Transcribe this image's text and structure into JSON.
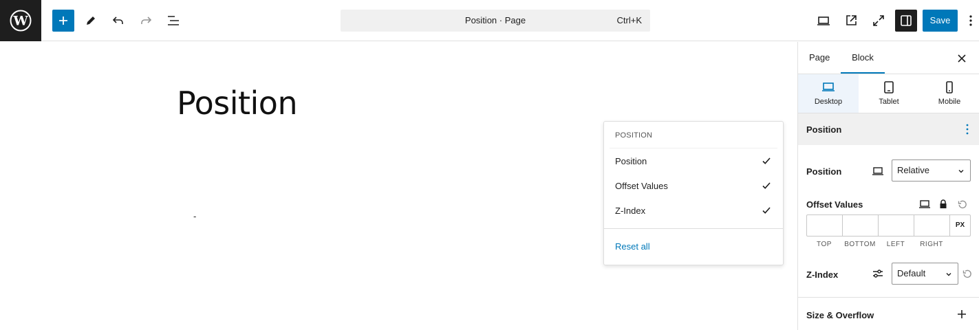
{
  "topbar": {
    "logo_icon": "wordpress-logo",
    "command_title": "Position · Page",
    "command_shortcut": "Ctrl+K",
    "save_label": "Save"
  },
  "canvas": {
    "heading": "Position",
    "placeholder": "-"
  },
  "popover": {
    "header": "POSITION",
    "items": [
      {
        "label": "Position",
        "checked": true
      },
      {
        "label": "Offset Values",
        "checked": true
      },
      {
        "label": "Z-Index",
        "checked": true
      }
    ],
    "reset_label": "Reset all"
  },
  "sidebar": {
    "tabs": [
      {
        "label": "Page"
      },
      {
        "label": "Block",
        "active": true
      }
    ],
    "devices": [
      {
        "label": "Desktop",
        "icon": "desktop-icon",
        "active": true
      },
      {
        "label": "Tablet",
        "icon": "tablet-icon"
      },
      {
        "label": "Mobile",
        "icon": "mobile-icon"
      }
    ],
    "panel_title": "Position",
    "position_label": "Position",
    "position_value": "Relative",
    "offset_label": "Offset Values",
    "offset_unit": "PX",
    "offset_sides": [
      "TOP",
      "BOTTOM",
      "LEFT",
      "RIGHT"
    ],
    "zindex_label": "Z-Index",
    "zindex_value": "Default",
    "size_overflow_label": "Size & Overflow"
  },
  "colors": {
    "accent": "#0078b9",
    "dark": "#1e1e1e"
  }
}
